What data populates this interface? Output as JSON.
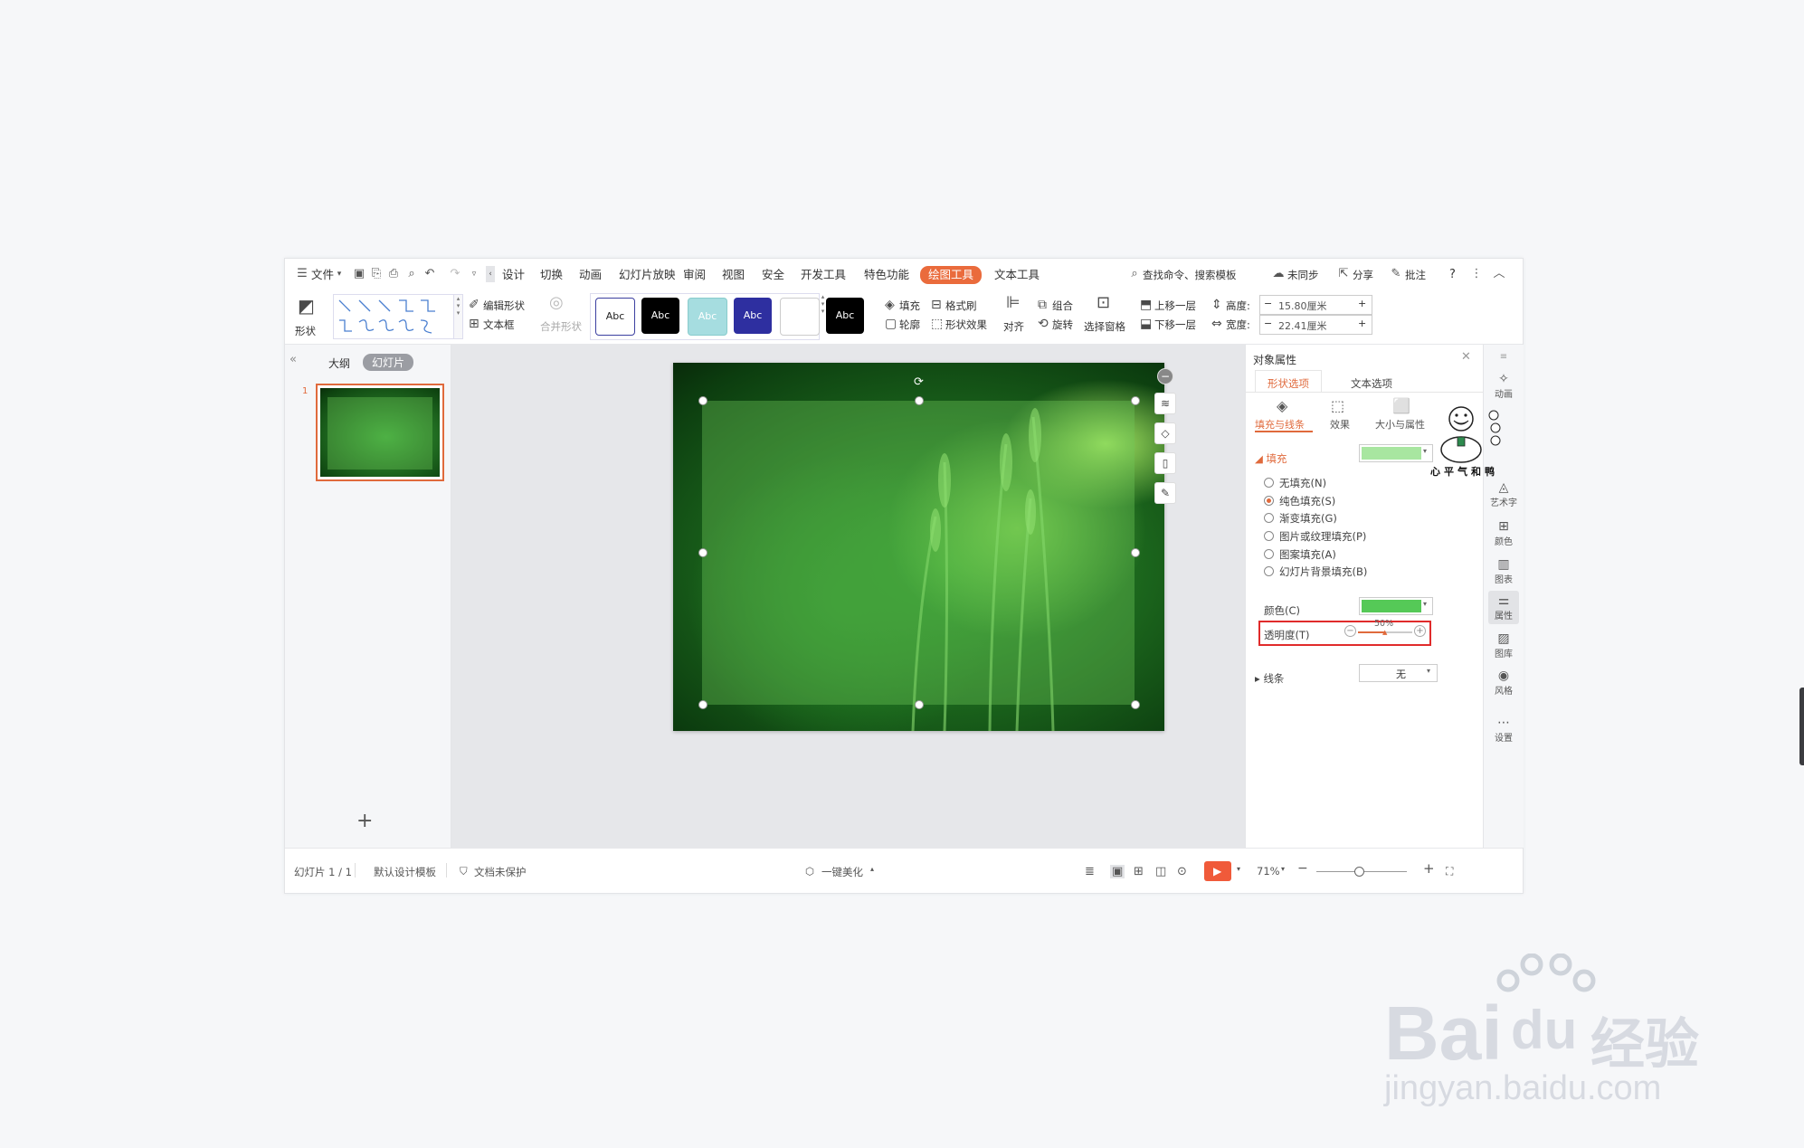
{
  "ribbon_tabs": {
    "file": "文件",
    "design": "设计",
    "transition": "切换",
    "animation": "动画",
    "slideshow": "幻灯片放映",
    "review": "审阅",
    "view": "视图",
    "security": "安全",
    "developer": "开发工具",
    "special": "特色功能",
    "drawing_tools": "绘图工具",
    "text_tools": "文本工具",
    "search": "查找命令、搜索模板",
    "sync": "未同步",
    "share": "分享",
    "comment": "批注",
    "help": "?"
  },
  "ribbon": {
    "shape": "形状",
    "edit_shape": "编辑形状",
    "textbox": "文本框",
    "merge_shape": "合并形状",
    "style_label": "Abc",
    "fill": "填充",
    "format_painter": "格式刷",
    "outline": "轮廓",
    "shape_effect": "形状效果",
    "align": "对齐",
    "group": "组合",
    "rotate": "旋转",
    "selection_pane": "选择窗格",
    "bring_forward": "上移一层",
    "send_backward": "下移一层",
    "height_label": "高度:",
    "height_value": "15.80厘米",
    "width_label": "宽度:",
    "width_value": "22.41厘米",
    "minus": "−",
    "plus": "+"
  },
  "thumbs": {
    "outline_tab": "大纲",
    "slides_tab": "幻灯片",
    "slide_number": "1",
    "add": "+",
    "collapse": "«"
  },
  "panel": {
    "title": "对象属性",
    "tab_shape": "形状选项",
    "tab_text": "文本选项",
    "sub_fill_line": "填充与线条",
    "sub_effect": "效果",
    "sub_size": "大小与属性",
    "fill_section": "填充",
    "opt_none": "无填充(N)",
    "opt_solid": "纯色填充(S)",
    "opt_gradient": "渐变填充(G)",
    "opt_picture": "图片或纹理填充(P)",
    "opt_pattern": "图案填充(A)",
    "opt_slide_bg": "幻灯片背景填充(B)",
    "color_label": "颜色(C)",
    "transparency_label": "透明度(T)",
    "transparency_value": "50%",
    "transparency_fraction": 0.5,
    "line_section": "线条",
    "line_value": "无",
    "fill_swatch_color": "#a8e6a0",
    "color_swatch_color": "#55c957",
    "highlight_color": "#e02b2b"
  },
  "rightbar": {
    "animation": "动画",
    "art_text": "艺术字",
    "color": "颜色",
    "chart": "图表",
    "properties": "属性",
    "library": "图库",
    "style": "风格",
    "settings": "设置"
  },
  "sticker": {
    "caption": "心平气和鸭"
  },
  "status": {
    "slide_info": "幻灯片 1 / 1",
    "template": "默认设计模板",
    "protection": "文档未保护",
    "beautify": "一键美化",
    "zoom": "71%"
  },
  "watermark": {
    "brand": "Bai",
    "brand2": "du",
    "cn": "经验",
    "url": "jingyan.baidu.com"
  },
  "colors": {
    "accent": "#ea6b3c",
    "play": "#f05a3a"
  }
}
